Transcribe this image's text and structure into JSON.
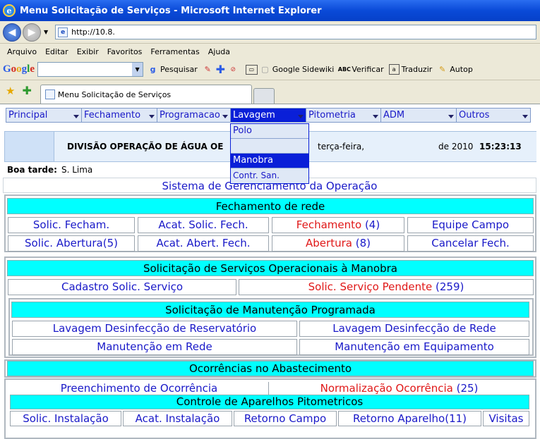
{
  "window": {
    "title": "Menu Solicitação de Serviços - Microsoft Internet Explorer",
    "ie_logo": "e"
  },
  "address_bar": {
    "url": "http://10.8.",
    "page_icon": "e"
  },
  "browser_menu": [
    "Arquivo",
    "Editar",
    "Exibir",
    "Favoritos",
    "Ferramentas",
    "Ajuda"
  ],
  "google_toolbar": {
    "logo": [
      "G",
      "o",
      "o",
      "g",
      "l",
      "e"
    ],
    "search_label": "Pesquisar",
    "sidewiki_label": "Google Sidewiki",
    "verificar_label": "Verificar",
    "traduzir_label": "Traduzir",
    "autop_label": "Autop"
  },
  "tab": {
    "label": "Menu Solicitação de Serviços"
  },
  "app_menu": {
    "items": [
      "Principal",
      "Fechamento",
      "Programacao",
      "Lavagem",
      "Pitometria",
      "ADM",
      "Outros"
    ],
    "active": "Lavagem",
    "dropdown": [
      "Polo",
      "",
      "Manobra",
      "Contr. San."
    ],
    "dropdown_selected": "Manobra"
  },
  "info": {
    "division_title": "DIVISÃO OPERAÇÃO DE ÁGUA OE",
    "weekday": "terça-feira,",
    "year": "de 2010",
    "time": "15:23:13"
  },
  "greeting": {
    "label": "Boa tarde:",
    "user": "S. Lima"
  },
  "system_title": "Sistema de Gerenciamento da Operação",
  "fechamento": {
    "title": "Fechamento de rede",
    "row1": [
      {
        "label": "Solic. Fecham.",
        "count": ""
      },
      {
        "label": "Acat. Solic. Fech.",
        "count": ""
      },
      {
        "label": "Fechamento",
        "count": "(4)"
      },
      {
        "label": "Equipe Campo",
        "count": ""
      }
    ],
    "row2": [
      {
        "label": "Solic. Abertura(5)",
        "count": ""
      },
      {
        "label": "Acat. Abert. Fech.",
        "count": ""
      },
      {
        "label": "Abertura",
        "count": "(8)"
      },
      {
        "label": "Cancelar Fech.",
        "count": ""
      }
    ]
  },
  "manobra": {
    "title": "Solicitação de Serviços Operacionais à Manobra",
    "cadastro": "Cadastro Solic. Serviço",
    "pendente_label": "Solic. Serviço Pendente",
    "pendente_count": "(259)"
  },
  "manutencao": {
    "title": "Solicitação de Manutenção Programada",
    "items": [
      "Lavagem Desinfecção de Reservatório",
      "Lavagem Desinfecção de Rede",
      "Manutenção em Rede",
      "Manutenção em Equipamento"
    ]
  },
  "ocorrencias": {
    "title": "Ocorrências no Abastecimento",
    "preenchimento": "Preenchimento de Ocorrência",
    "normalizacao_label": "Normalização Ocorrência",
    "normalizacao_count": "(25)"
  },
  "pitometria": {
    "title": "Controle de Aparelhos Pitometricos",
    "items": [
      "Solic. Instalação",
      "Acat. Instalação",
      "Retorno Campo",
      "Retorno Aparelho(11)",
      "Visitas"
    ]
  },
  "colors": {
    "accent_blue": "#1919c8",
    "alert_red": "#e01818",
    "header_cyan": "#00ffff",
    "menu_active": "#0a1fd8"
  }
}
